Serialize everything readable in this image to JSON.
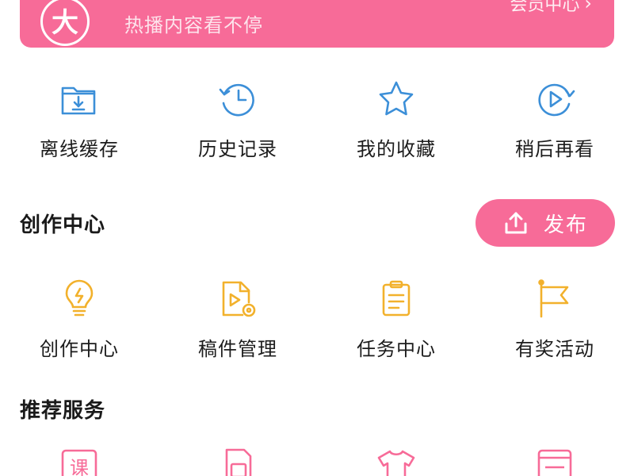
{
  "vip": {
    "badge": "大",
    "subtitle": "热播内容看不停",
    "link": "会员中心",
    "chevron": "›",
    "color": "#f76b98"
  },
  "quick": {
    "items": [
      {
        "label": "离线缓存",
        "icon": "offline-cache-folder-icon"
      },
      {
        "label": "历史记录",
        "icon": "history-clock-icon"
      },
      {
        "label": "我的收藏",
        "icon": "favorite-star-icon"
      },
      {
        "label": "稍后再看",
        "icon": "watch-later-icon"
      }
    ],
    "icon_color": "#3c8fd8"
  },
  "creation": {
    "title": "创作中心",
    "publish_label": "发布",
    "publish_icon": "upload-icon",
    "items": [
      {
        "label": "创作中心",
        "icon": "lightbulb-icon"
      },
      {
        "label": "稿件管理",
        "icon": "manuscript-video-file-icon"
      },
      {
        "label": "任务中心",
        "icon": "clipboard-task-icon"
      },
      {
        "label": "有奖活动",
        "icon": "flag-icon"
      }
    ],
    "icon_color": "#f2b12c"
  },
  "recommend": {
    "title": "推荐服务",
    "items": [
      {
        "label": "课",
        "icon": "course-icon"
      },
      {
        "label": "",
        "icon": "sim-card-icon"
      },
      {
        "label": "",
        "icon": "tshirt-icon"
      },
      {
        "label": "",
        "icon": "wallet-card-icon"
      }
    ],
    "icon_color": "#f76b98"
  }
}
